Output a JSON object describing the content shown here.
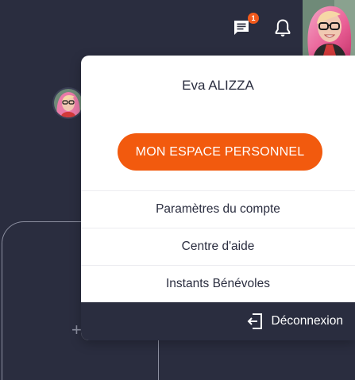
{
  "colors": {
    "background": "#2a2d3f",
    "accent": "#f25a0e",
    "menu_text": "#2a2d3f",
    "badge": "#f25a1c"
  },
  "header": {
    "messages_icon": "chat-bubble-icon",
    "messages_badge": "1",
    "notifications_icon": "bell-icon",
    "avatar": "user-avatar-photo"
  },
  "user_menu": {
    "user_name": "Eva ALIZZA",
    "primary_button_label": "MON ESPACE PERSONNEL",
    "items": [
      {
        "label": "Paramètres du compte"
      },
      {
        "label": "Centre d'aide"
      },
      {
        "label": "Instants Bénévoles"
      }
    ],
    "logout_icon": "logout-icon",
    "logout_label": "Déconnexion"
  },
  "background_page": {
    "plus_icon": "+"
  }
}
